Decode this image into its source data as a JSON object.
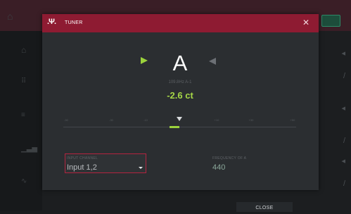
{
  "modal": {
    "title": "TUNER",
    "icon": "tuner-icon",
    "close_icon": "close-icon"
  },
  "tuner": {
    "note": "A",
    "frequency_readout": "109.8Hz A-1",
    "cents": "-2.6 ct",
    "offset_cents": -2.6,
    "scale_labels": [
      "-50",
      "-30",
      "-10",
      "+10",
      "+30",
      "+50"
    ]
  },
  "input_channel": {
    "label": "INPUT CHANNEL",
    "value": "Input 1,2"
  },
  "frequency_of_a": {
    "label": "FREQUENCY OF A",
    "value": "440"
  },
  "footer": {
    "close_label": "CLOSE"
  },
  "colors": {
    "header": "#8e1b32",
    "accent_green": "#9bd23c",
    "field_border": "#b3243f"
  }
}
